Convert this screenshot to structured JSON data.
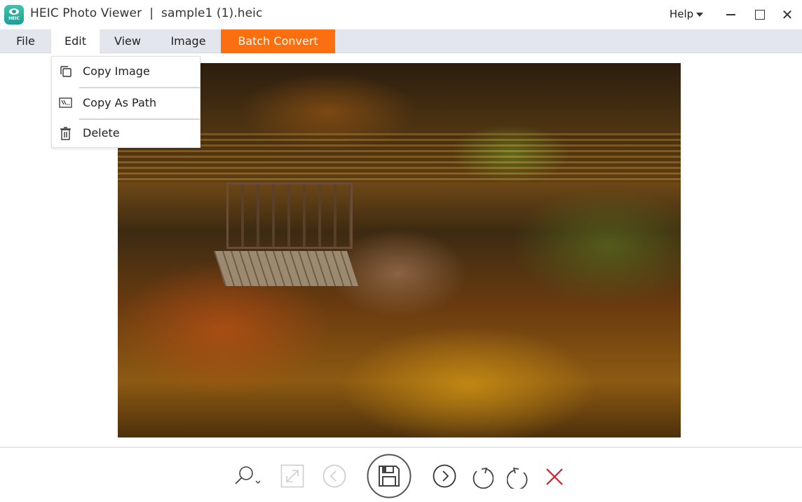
{
  "window": {
    "app_name": "HEIC Photo Viewer",
    "title": "HEIC Photo Viewer  |  sample1 (1).heic",
    "logo_text": "HEIC",
    "help_label": "Help",
    "close_glyph": "✕"
  },
  "menubar": {
    "items": [
      {
        "label": "File"
      },
      {
        "label": "Edit"
      },
      {
        "label": "View"
      },
      {
        "label": "Image"
      },
      {
        "label": "Batch Convert"
      }
    ],
    "accent_color": "#fb6f10"
  },
  "edit_menu": {
    "items": [
      {
        "label": "Copy Image",
        "icon": "copy-icon"
      },
      {
        "label": "Copy As Path",
        "icon": "path-icon"
      },
      {
        "label": "Delete",
        "icon": "trash-icon"
      }
    ]
  },
  "viewer": {
    "image_description": "Autumn pond reflection with wooden dock (image shown upside down)"
  },
  "toolbar": {
    "buttons": [
      {
        "name": "zoom",
        "icon": "magnifier-dropdown-icon",
        "enabled": true
      },
      {
        "name": "fit-to-window",
        "icon": "expand-icon",
        "enabled": false
      },
      {
        "name": "previous",
        "icon": "chevron-left-circle-icon",
        "enabled": false
      },
      {
        "name": "save",
        "icon": "floppy-disk-icon",
        "enabled": true
      },
      {
        "name": "next",
        "icon": "chevron-right-circle-icon",
        "enabled": true
      },
      {
        "name": "rotate-left",
        "icon": "rotate-ccw-icon",
        "enabled": true
      },
      {
        "name": "rotate-right",
        "icon": "rotate-cw-icon",
        "enabled": true
      },
      {
        "name": "close-image",
        "icon": "red-x-icon",
        "enabled": true
      }
    ],
    "delete_color": "#d0202a"
  }
}
